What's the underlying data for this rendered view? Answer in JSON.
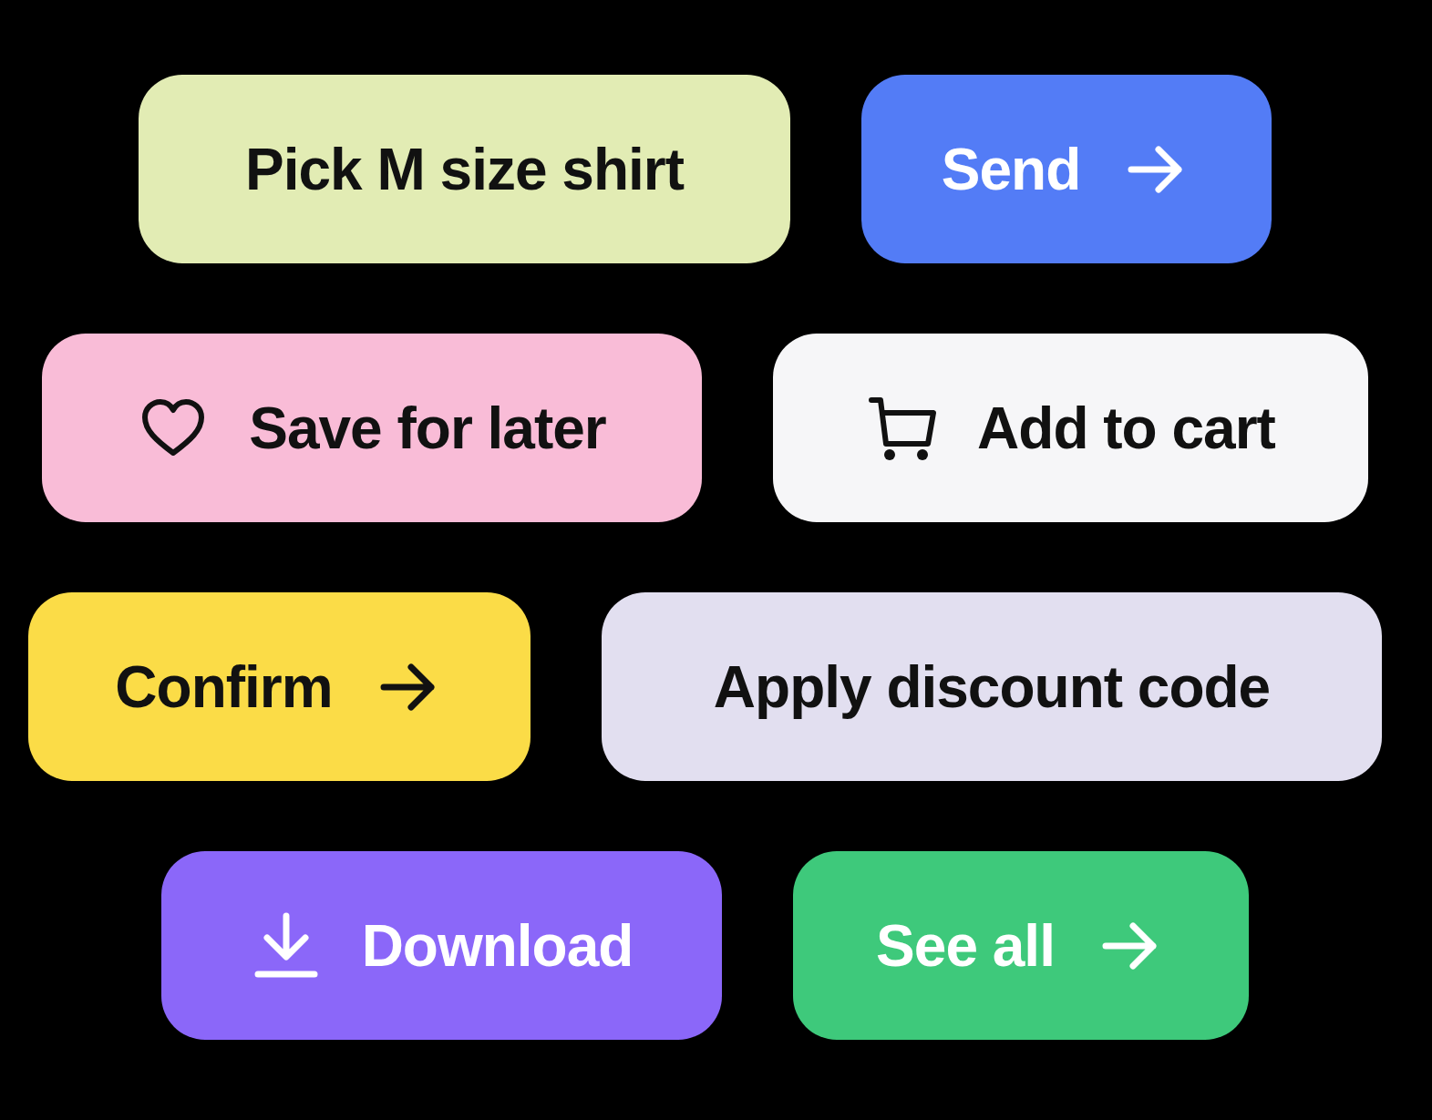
{
  "button_rows": [
    {
      "buttons": [
        {
          "label": "Pick M size shirt",
          "color": "#e2ecb4",
          "kind": "plain"
        },
        {
          "label": "Send",
          "color": "#537cf6",
          "kind": "arrow"
        }
      ]
    },
    {
      "buttons": [
        {
          "label": "Save for later",
          "color": "#f9bcd7",
          "kind": "heart"
        },
        {
          "label": "Add to cart",
          "color": "#f6f6f8",
          "kind": "cart"
        }
      ]
    },
    {
      "buttons": [
        {
          "label": "Confirm",
          "color": "#fbdc47",
          "kind": "arrow"
        },
        {
          "label": "Apply discount code",
          "color": "#e2dff0",
          "kind": "plain"
        }
      ]
    },
    {
      "buttons": [
        {
          "label": "Download",
          "color": "#8b67f9",
          "kind": "download"
        },
        {
          "label": "See all",
          "color": "#3ec97b",
          "kind": "arrow"
        }
      ]
    }
  ]
}
